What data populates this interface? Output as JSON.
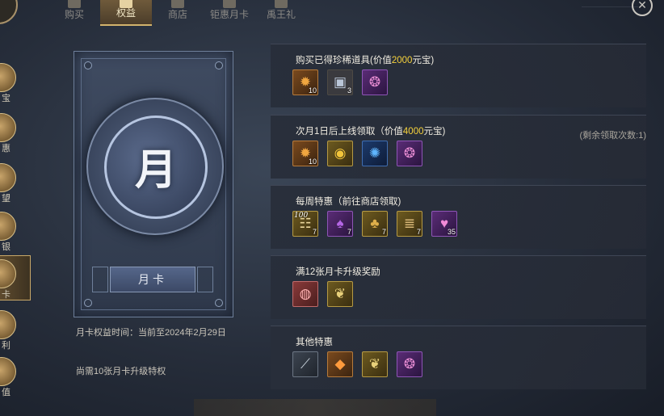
{
  "tabs": [
    {
      "label": "购买",
      "active": false
    },
    {
      "label": "权益",
      "active": true
    },
    {
      "label": "商店",
      "active": false
    },
    {
      "label": "钜惠月卡",
      "active": false
    },
    {
      "label": "禹王礼",
      "active": false
    }
  ],
  "side_nav": [
    "宝",
    "惠",
    "望",
    "银",
    "卡",
    "利",
    "值"
  ],
  "card": {
    "emblem_char": "月",
    "label": "月卡",
    "period_text": "月卡权益时间：当前至2024年2月29日",
    "upgrade_note": "尚需10张月卡升级特权"
  },
  "rows": [
    {
      "title_pre": "购买已得珍稀道具(价值",
      "title_num": "2000",
      "title_post": "元宝)",
      "remain": "",
      "items": [
        {
          "icon": "orange-gear-icon",
          "glyph": "✹",
          "count": "10",
          "quality": "orange",
          "tl": ""
        },
        {
          "icon": "silver-chest-icon",
          "glyph": "▣",
          "count": "3",
          "quality": "",
          "tl": ""
        },
        {
          "icon": "purple-pouch-icon",
          "glyph": "❂",
          "count": "",
          "quality": "purple",
          "tl": ""
        }
      ]
    },
    {
      "title_pre": "次月1日后上线领取（价值",
      "title_num": "4000",
      "title_post": "元宝)",
      "remain": "(剩余领取次数:1)",
      "items": [
        {
          "icon": "orange-gear-icon",
          "glyph": "✹",
          "count": "10",
          "quality": "orange",
          "tl": ""
        },
        {
          "icon": "gold-ingot-icon",
          "glyph": "◉",
          "count": "",
          "quality": "gold",
          "tl": ""
        },
        {
          "icon": "blue-orb-icon",
          "glyph": "✺",
          "count": "",
          "quality": "",
          "tl": ""
        },
        {
          "icon": "purple-pouch-icon",
          "glyph": "❂",
          "count": "",
          "quality": "purple",
          "tl": ""
        }
      ]
    },
    {
      "title_pre": "每周特惠（前往商店领取)",
      "title_num": "",
      "title_post": "",
      "remain": "",
      "items": [
        {
          "icon": "gold-scroll-icon",
          "glyph": "☷",
          "count": "7",
          "quality": "gold",
          "tl": "100"
        },
        {
          "icon": "purple-gourd-icon",
          "glyph": "♠",
          "count": "7",
          "quality": "purple",
          "tl": ""
        },
        {
          "icon": "treasure-bag-icon",
          "glyph": "♣",
          "count": "7",
          "quality": "gold",
          "tl": ""
        },
        {
          "icon": "ancient-scroll-icon",
          "glyph": "≣",
          "count": "7",
          "quality": "gold",
          "tl": ""
        },
        {
          "icon": "pink-potion-icon",
          "glyph": "♥",
          "count": "35",
          "quality": "purple",
          "tl": ""
        }
      ]
    },
    {
      "title_pre": "满12张月卡升级奖励",
      "title_num": "",
      "title_post": "",
      "remain": "",
      "items": [
        {
          "icon": "pink-jade-icon",
          "glyph": "◍",
          "count": "",
          "quality": "",
          "tl": ""
        },
        {
          "icon": "gold-feather-icon",
          "glyph": "❦",
          "count": "",
          "quality": "gold",
          "tl": ""
        }
      ]
    },
    {
      "title_pre": "其他特惠",
      "title_num": "",
      "title_post": "",
      "remain": "",
      "items": [
        {
          "icon": "silver-blade-icon",
          "glyph": "⟋",
          "count": "",
          "quality": "",
          "tl": ""
        },
        {
          "icon": "orange-token-icon",
          "glyph": "◆",
          "count": "",
          "quality": "orange",
          "tl": ""
        },
        {
          "icon": "gold-feather-icon",
          "glyph": "❦",
          "count": "",
          "quality": "gold",
          "tl": ""
        },
        {
          "icon": "purple-pouch-icon",
          "glyph": "❂",
          "count": "",
          "quality": "purple",
          "tl": ""
        }
      ]
    }
  ]
}
